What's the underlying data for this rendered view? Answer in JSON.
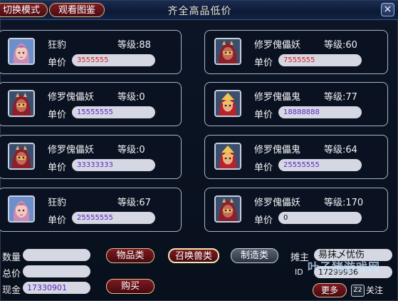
{
  "window": {
    "title": "齐全高品低价",
    "tab_switch_mode": "切换模式",
    "tab_view_catalog": "观看图鉴",
    "close_symbol": "×"
  },
  "labels": {
    "level_prefix": "等级:",
    "unit_price": "单价"
  },
  "listings": [
    {
      "name": "狂豹",
      "level": "等级:88",
      "price": "3555555",
      "price_color": "#d81e1e",
      "avatar": "kuangbao"
    },
    {
      "name": "修罗傀儡妖",
      "level": "等级:60",
      "price": "7555555",
      "price_color": "#d81e1e",
      "avatar": "yao"
    },
    {
      "name": "修罗傀儡妖",
      "level": "等级:0",
      "price": "15555555",
      "price_color": "#5b1fc9",
      "avatar": "yao"
    },
    {
      "name": "修罗傀儡鬼",
      "level": "等级:77",
      "price": "18888888",
      "price_color": "#5b1fc9",
      "avatar": "gui"
    },
    {
      "name": "修罗傀儡妖",
      "level": "等级:0",
      "price": "33333333",
      "price_color": "#5b1fc9",
      "avatar": "yao"
    },
    {
      "name": "修罗傀儡鬼",
      "level": "等级:64",
      "price": "25555555",
      "price_color": "#5b1fc9",
      "avatar": "gui"
    },
    {
      "name": "狂豹",
      "level": "等级:67",
      "price": "25555555",
      "price_color": "#5b1fc9",
      "avatar": "kuangbao"
    },
    {
      "name": "修罗傀儡妖",
      "level": "等级:170",
      "price": "0",
      "price_color": "#111111",
      "avatar": "yao"
    }
  ],
  "footer": {
    "quantity_label": "数量",
    "quantity_value": "",
    "total_label": "总价",
    "total_value": "",
    "cash_label": "现金",
    "cash_value": "17330901",
    "btn_items": "物品类",
    "btn_summon": "召唤兽类",
    "btn_craft": "制造类",
    "btn_buy": "购买",
    "stall_owner_label": "摊主",
    "stall_owner_value": "易抹乄忧伤",
    "id_label": "ID",
    "id_value": "17299936",
    "btn_more": "更多",
    "btn_follow": "关注",
    "follow_icon_text": "Z2",
    "watermark": "叶子猪游戏网"
  }
}
